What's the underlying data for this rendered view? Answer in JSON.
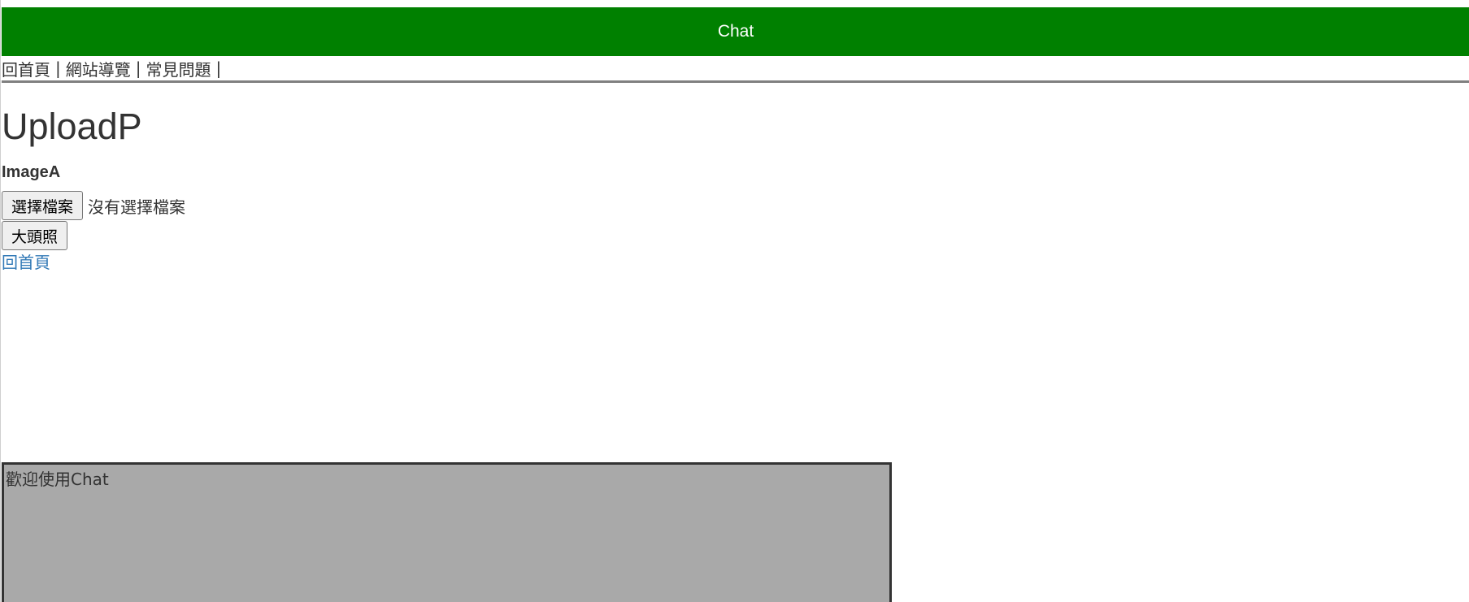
{
  "header": {
    "title": "Chat",
    "background_color": "#008000"
  },
  "nav": {
    "items": [
      {
        "label": "回首頁"
      },
      {
        "label": "網站導覽"
      },
      {
        "label": "常見問題"
      }
    ],
    "separator": "|"
  },
  "main": {
    "title": "UploadP",
    "field_label": "ImageA",
    "file_input": {
      "button_label": "選擇檔案",
      "status_text": "沒有選擇檔案"
    },
    "submit_label": "大頭照",
    "back_link": "回首頁",
    "link_color": "#337ab7"
  },
  "chat": {
    "welcome_text": "歡迎使用Chat",
    "background_color": "#a9a9a9"
  }
}
